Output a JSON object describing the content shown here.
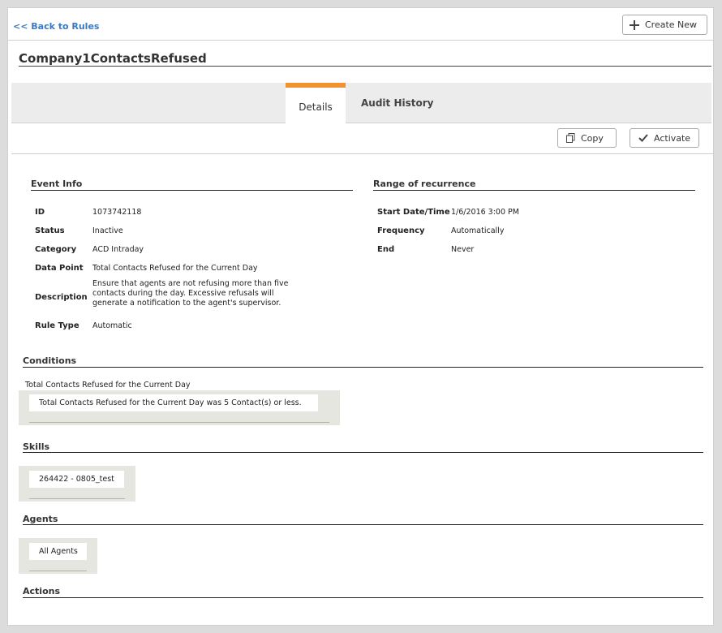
{
  "nav": {
    "back_label": "<< Back to Rules"
  },
  "toolbar": {
    "create_new_label": "Create New",
    "copy_label": "Copy",
    "activate_label": "Activate"
  },
  "page": {
    "title": "Company1ContactsRefused"
  },
  "tabs": [
    {
      "label": "Details",
      "active": true
    },
    {
      "label": "Audit History",
      "active": false
    }
  ],
  "colors": {
    "accent": "#f0922f",
    "link": "#3a7bbf"
  },
  "event_info": {
    "title": "Event Info",
    "rows": [
      {
        "label": "ID",
        "value": "1073742118"
      },
      {
        "label": "Status",
        "value": "Inactive"
      },
      {
        "label": "Category",
        "value": "ACD Intraday"
      },
      {
        "label": "Data Point",
        "value": "Total Contacts Refused for the Current Day"
      },
      {
        "label": "Description",
        "value": "Ensure that agents are not refusing more than five contacts during the day. Excessive refusals will generate a notification to the agent's supervisor."
      },
      {
        "label": "Rule Type",
        "value": "Automatic"
      }
    ]
  },
  "recurrence": {
    "title": "Range of recurrence",
    "rows": [
      {
        "label": "Start Date/Time",
        "value": "1/6/2016 3:00 PM"
      },
      {
        "label": "Frequency",
        "value": "Automatically"
      },
      {
        "label": "End",
        "value": "Never"
      }
    ]
  },
  "conditions": {
    "title": "Conditions",
    "subtitle": "Total Contacts Refused for the Current Day",
    "items": [
      "Total Contacts Refused for the Current Day was 5 Contact(s) or less."
    ]
  },
  "skills": {
    "title": "Skills",
    "items": [
      "264422 - 0805_test"
    ]
  },
  "agents": {
    "title": "Agents",
    "items": [
      "All Agents"
    ]
  },
  "actions": {
    "title": "Actions"
  }
}
